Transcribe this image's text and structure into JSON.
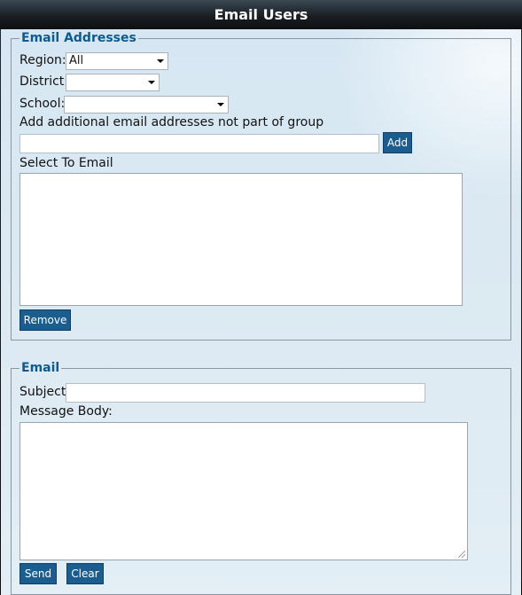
{
  "window": {
    "title": "Email Users"
  },
  "email_addresses": {
    "legend": "Email Addresses",
    "region_label": "Region:",
    "region_value": "All",
    "district_label": "District:",
    "district_value": "",
    "school_label": "School:",
    "school_value": "",
    "additional_label": "Add additional email addresses not part of group",
    "additional_value": "",
    "add_button": "Add",
    "select_label": "Select To Email",
    "remove_button": "Remove"
  },
  "email": {
    "legend": "Email",
    "subject_label": "Subject:",
    "subject_value": "",
    "body_label": "Message Body:",
    "body_value": "",
    "send_button": "Send",
    "clear_button": "Clear"
  },
  "icons": {
    "dropdown": "chevron-down-icon",
    "resize": "resize-grip-icon"
  }
}
